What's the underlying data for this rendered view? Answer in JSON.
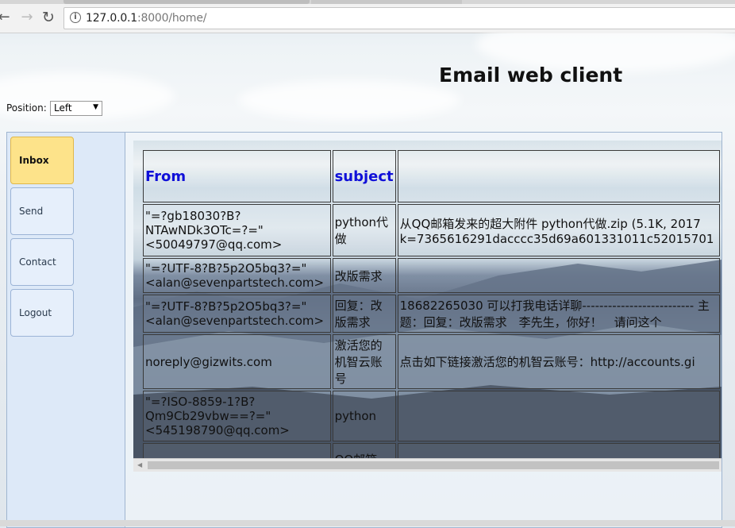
{
  "browser": {
    "url_host": "127.0.0.1",
    "url_path": ":8000/home/"
  },
  "app_title": "Email web client",
  "position": {
    "label": "Position:",
    "selected": "Left"
  },
  "sidebar": {
    "items": [
      {
        "label": "Inbox",
        "active": true
      },
      {
        "label": "Send"
      },
      {
        "label": "Contact"
      },
      {
        "label": "Logout"
      }
    ]
  },
  "inbox": {
    "headers": {
      "from": "From",
      "subject": "subject",
      "body": ""
    },
    "rows": [
      {
        "from": "\"=?gb18030?B?NTAwNDk3OTc=?=\" <50049797@qq.com>",
        "subject": "python代做",
        "body": "从QQ邮箱发来的超大附件 python代做.zip (5.1K, 2017 k=7365616291dacccc35d69a601331011c52015701"
      },
      {
        "from": "\"=?UTF-8?B?5p2O5bq3?=\" <alan@sevenpartstech.com>",
        "subject": "改版需求",
        "body": ""
      },
      {
        "from": "\"=?UTF-8?B?5p2O5bq3?=\" <alan@sevenpartstech.com>",
        "subject": "回复：改版需求",
        "body": "18682265030 可以打我电话详聊-------------------------- 主　题：回复：改版需求　李先生，你好！　请问这个"
      },
      {
        "from": "noreply@gizwits.com",
        "subject": "激活您的机智云账号",
        "body": "点击如下链接激活您的机智云账号：http://accounts.gi"
      },
      {
        "from": "\"=?ISO-8859-1?B?Qm9Cb29vbw==?=\" <545198790@qq.com>",
        "subject": "python",
        "body": ""
      },
      {
        "from": "",
        "subject": "QQ邮箱",
        "body": ""
      }
    ]
  }
}
